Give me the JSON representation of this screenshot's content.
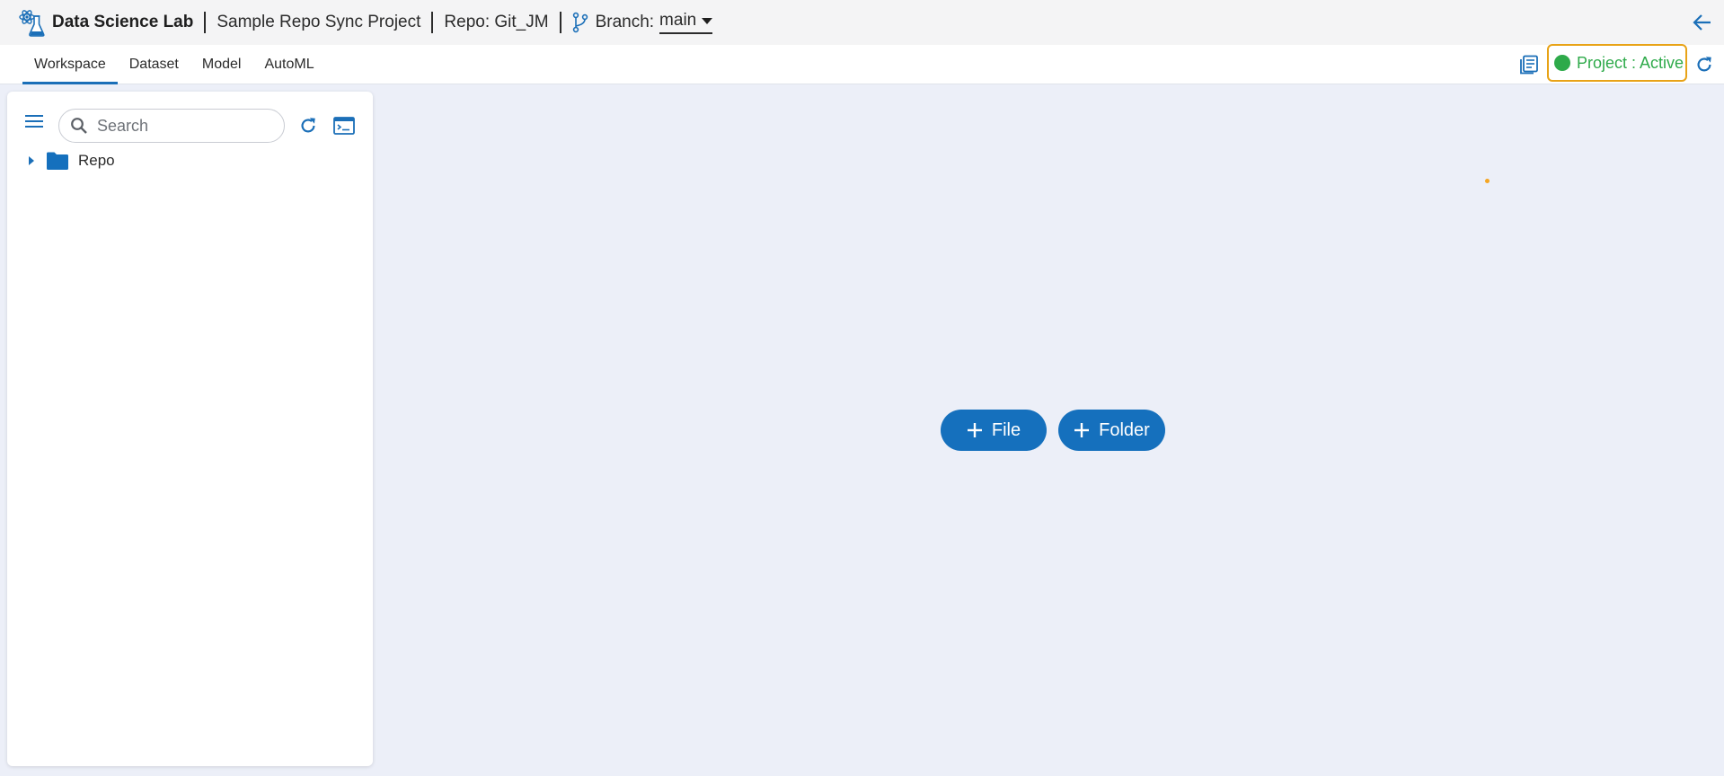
{
  "header": {
    "app_title": "Data Science Lab",
    "project_name": "Sample Repo Sync Project",
    "repo": "Repo: Git_JM",
    "branch_label": "Branch:",
    "branch_value": "main",
    "logo_icon": "flask-atom-icon",
    "back_icon": "arrow-left-icon"
  },
  "tabs": [
    {
      "label": "Workspace",
      "active": true
    },
    {
      "label": "Dataset",
      "active": false
    },
    {
      "label": "Model",
      "active": false
    },
    {
      "label": "AutoML",
      "active": false
    }
  ],
  "status": {
    "label": "Project : Active",
    "dot_color": "#2eaa4a",
    "border_color": "#e8a317"
  },
  "sidebar": {
    "search_placeholder": "Search",
    "tree": [
      {
        "label": "Repo",
        "type": "folder",
        "expanded": false
      }
    ]
  },
  "actions": {
    "file_label": "File",
    "folder_label": "Folder"
  },
  "colors": {
    "accent": "#1570bd",
    "canvas_bg": "#eceff8"
  }
}
